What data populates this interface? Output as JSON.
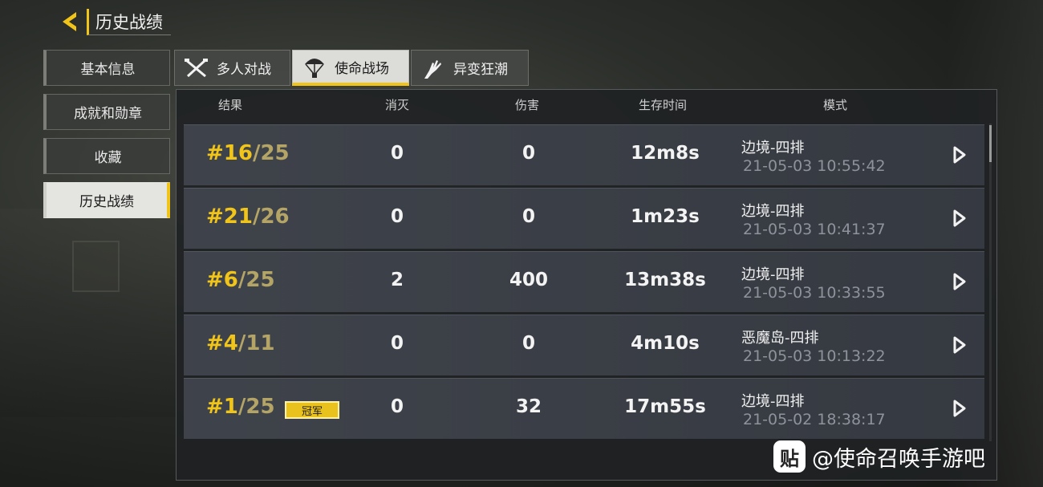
{
  "header": {
    "title": "历史战绩"
  },
  "sidebar": {
    "items": [
      {
        "label": "基本信息"
      },
      {
        "label": "成就和勋章"
      },
      {
        "label": "收藏"
      },
      {
        "label": "历史战绩"
      }
    ]
  },
  "tabs": [
    {
      "label": "多人对战",
      "icon": "crossed-weapons-icon"
    },
    {
      "label": "使命战场",
      "icon": "parachute-icon"
    },
    {
      "label": "异变狂潮",
      "icon": "zombie-hand-icon"
    }
  ],
  "table": {
    "columns": [
      "结果",
      "消灭",
      "伤害",
      "生存时间",
      "模式"
    ],
    "rows": [
      {
        "rank": "#16",
        "total": "/25",
        "kills": "0",
        "damage": "0",
        "time": "12m8s",
        "mode": "边境-四排",
        "date": "21-05-03 10:55:42"
      },
      {
        "rank": "#21",
        "total": "/26",
        "kills": "0",
        "damage": "0",
        "time": "1m23s",
        "mode": "边境-四排",
        "date": "21-05-03 10:41:37"
      },
      {
        "rank": "#6",
        "total": "/25",
        "kills": "2",
        "damage": "400",
        "time": "13m38s",
        "mode": "边境-四排",
        "date": "21-05-03 10:33:55"
      },
      {
        "rank": "#4",
        "total": "/11",
        "kills": "0",
        "damage": "0",
        "time": "4m10s",
        "mode": "恶魔岛-四排",
        "date": "21-05-03 10:13:22"
      },
      {
        "rank": "#1",
        "total": "/25",
        "badge": "冠军",
        "kills": "0",
        "damage": "32",
        "time": "17m55s",
        "mode": "边境-四排",
        "date": "21-05-02 18:38:17"
      }
    ]
  },
  "watermark": {
    "logo": "贴",
    "text": "@使命召唤手游吧"
  },
  "colors": {
    "accent": "#f0c419",
    "rank_total": "#b4a566",
    "date": "#8e939b"
  }
}
